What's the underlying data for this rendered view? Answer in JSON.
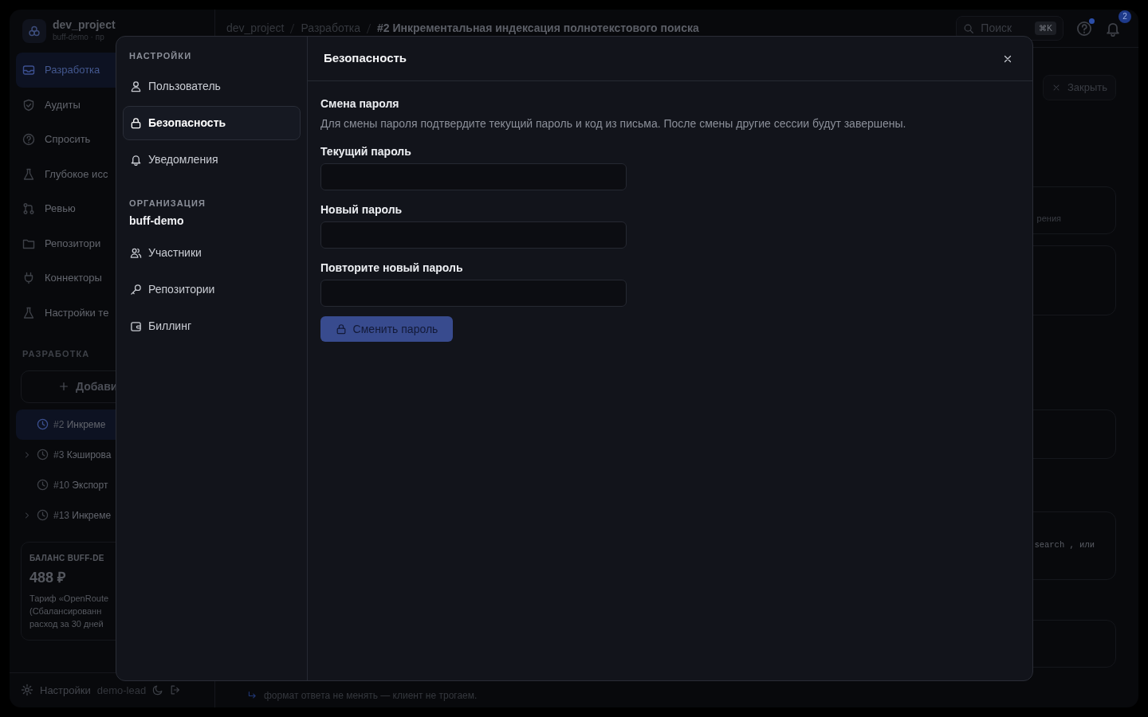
{
  "app": {
    "project": {
      "name": "dev_project",
      "subtitle": "buff-demo · пр"
    },
    "nav": [
      {
        "label": "Разработка",
        "selected": true
      },
      {
        "label": "Аудиты",
        "selected": false
      },
      {
        "label": "Спросить",
        "selected": false
      },
      {
        "label": "Глубокое исс",
        "selected": false
      },
      {
        "label": "Ревью",
        "selected": false
      },
      {
        "label": "Репозитори",
        "selected": false
      },
      {
        "label": "Коннекторы",
        "selected": false
      },
      {
        "label": "Настройки те",
        "selected": false
      }
    ],
    "section_label": "РАЗРАБОТКА",
    "add_button": "Добави",
    "tasks": [
      {
        "number": "#2",
        "title": "Инкреме",
        "expandable": false,
        "selected": true
      },
      {
        "number": "#3",
        "title": "Кэширова",
        "expandable": true,
        "selected": false
      },
      {
        "number": "#10",
        "title": "Экспорт",
        "expandable": false,
        "selected": false
      },
      {
        "number": "#13",
        "title": "Инкреме",
        "expandable": true,
        "selected": false
      }
    ],
    "balance": {
      "label": "БАЛАНС BUFF-DE",
      "amount": "488 ₽",
      "lines": [
        "Тариф «OpenRoute",
        "(Сбалансированн",
        "расход за 30 дней"
      ]
    },
    "footer": {
      "settings": "Настройки",
      "user": "demo-lead"
    }
  },
  "topbar": {
    "breadcrumbs": [
      "dev_project",
      "Разработка",
      "#2 Инкрементальная индексация полнотекстового поиска"
    ],
    "search": {
      "placeholder": "Поиск",
      "shortcut": "⌘K"
    },
    "help_unread": true,
    "notifications": "2"
  },
  "main": {
    "close_button": "Закрыть",
    "snippets": [
      "рения",
      "search , или"
    ],
    "reply_note": "формат ответа не менять — клиент не трогаем."
  },
  "modal": {
    "nav_title": "НАСТРОЙКИ",
    "nav": [
      {
        "label": "Пользователь",
        "selected": false
      },
      {
        "label": "Безопасность",
        "selected": true
      },
      {
        "label": "Уведомления",
        "selected": false
      }
    ],
    "org_title": "ОРГАНИЗАЦИЯ",
    "org_name": "buff-demo",
    "org_nav": [
      {
        "label": "Участники",
        "selected": false
      },
      {
        "label": "Репозитории",
        "selected": false
      },
      {
        "label": "Биллинг",
        "selected": false
      }
    ],
    "title": "Безопасность",
    "section": {
      "title": "Смена пароля",
      "description": "Для смены пароля подтвердите текущий пароль и код из письма. После смены другие сессии будут завершены."
    },
    "fields": [
      {
        "label": "Текущий пароль"
      },
      {
        "label": "Новый пароль"
      },
      {
        "label": "Повторите новый пароль"
      }
    ],
    "submit": {
      "label": "Сменить пароль",
      "disabled": true
    }
  }
}
